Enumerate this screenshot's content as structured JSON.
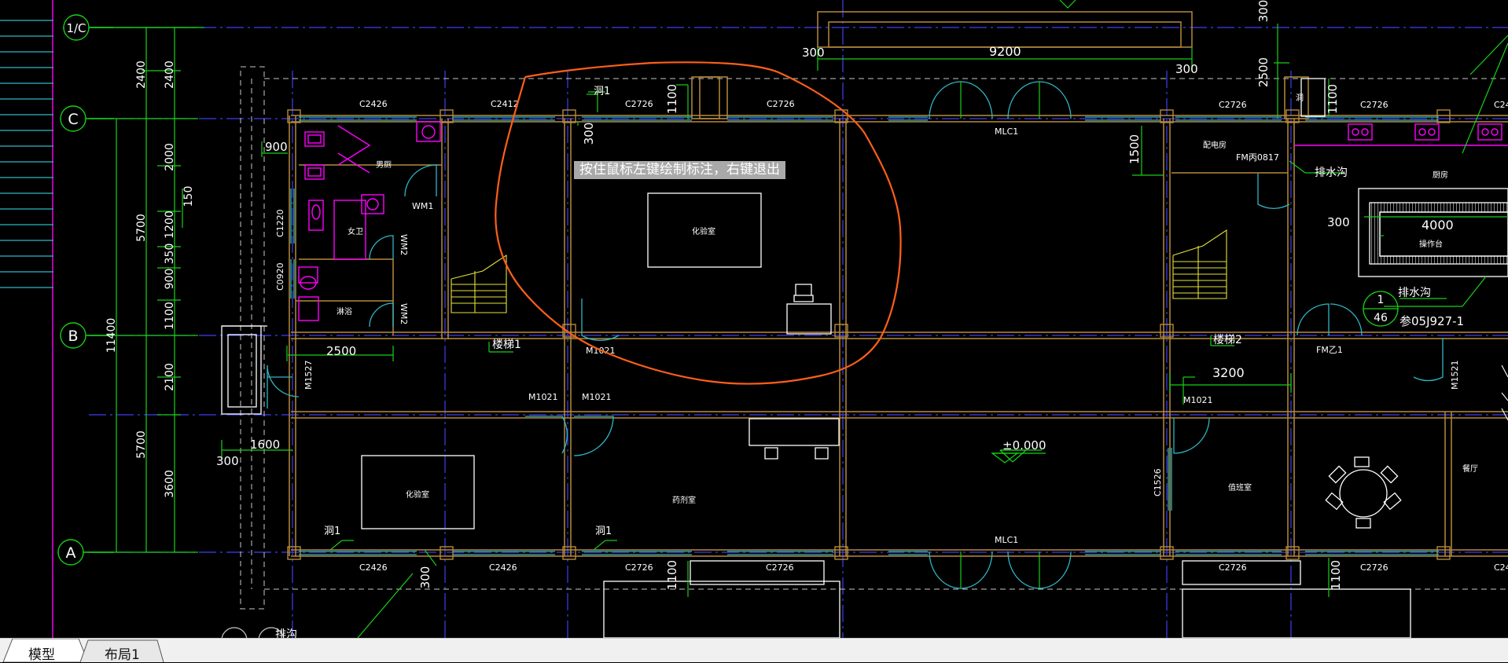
{
  "app": {
    "colors": {
      "background": "#000000",
      "wall": "#b58a3c",
      "grid": "#3f3ff5",
      "dim": "#17d017",
      "window": "#2fb6c4",
      "fixture": "#ff00ff",
      "stair": "#e6e23a",
      "markup": "#ff5f1a",
      "text": "#ffffff"
    }
  },
  "prompt": {
    "text": "按住鼠标左键绘制标注，右键退出"
  },
  "tabs": [
    {
      "label": "模型",
      "active": true
    },
    {
      "label": "布局1",
      "active": false
    }
  ],
  "axes": {
    "a1c": "1/C",
    "c": "C",
    "b": "B",
    "a": "A",
    "tag1": "1",
    "tag46": "46",
    "tag_ref": "参05J927-1"
  },
  "dims_left": {
    "d2400a": "2400",
    "d2400b": "2400",
    "d2000": "2000",
    "d1200": "1200",
    "d350": "350",
    "d900": "900",
    "d1100": "1100",
    "d2100": "2100",
    "d3600": "3600",
    "d5700a": "5700",
    "d5700b": "5700",
    "d11400": "11400",
    "d150": "150"
  },
  "dims_plan": {
    "d300a": "300",
    "d9200": "9200",
    "d300b": "300",
    "d2500": "2500",
    "d300c": "300",
    "d300d": "300",
    "d1100a": "1100",
    "d1100b": "1100",
    "d1500": "1500",
    "d900": "900",
    "d2500b": "2500",
    "d1600": "1600",
    "d300e": "300",
    "d300f": "300",
    "d3200": "3200",
    "d300g": "300",
    "d4000": "4000",
    "d1100c": "1100",
    "d1100d": "1100"
  },
  "labels": {
    "c2426a": "C2426",
    "c2412": "C2412",
    "c2726a": "C2726",
    "c2726b": "C2726",
    "c2726c": "C2726",
    "c2426b": "C2426",
    "c2426c": "C2426",
    "c2726d": "C2726",
    "c2726e": "C2726",
    "c2726f": "C2726",
    "c2726g": "C2726",
    "c2726h": "C2726",
    "c2_edge_top": "C24",
    "c2_edge_bot": "C24",
    "mlc1a": "MLC1",
    "mlc1b": "MLC1",
    "fm0817": "FM丙0817",
    "fmz1": "FM乙1",
    "wm1": "WM1",
    "wm2a": "WM2",
    "wm2b": "WM2",
    "m1527": "M1527",
    "m1521": "M1521",
    "m1021a": "M1021",
    "m1021b": "M1021",
    "m1021c": "M1021",
    "m1021d": "M1021",
    "c1220": "C1220",
    "c0920": "C0920",
    "c1526": "C1526",
    "dong1a": "洞1",
    "dong1b": "洞1",
    "dong1c": "洞1",
    "dong_small": "洞",
    "stair1": "楼梯1",
    "stair2": "楼梯2",
    "nanyu": "男厕",
    "nvyu": "女卫",
    "linyu": "淋浴",
    "room_center": "化验室",
    "room_left": "化验室",
    "room_mid": "药剂室",
    "room_r1": "配电房",
    "room_r2": "值班室",
    "kitchen": "厨房",
    "canting": "餐厅",
    "caozuotai": "操作台",
    "drain_a": "排水沟",
    "drain_b": "排水沟",
    "drain_c": "排沟",
    "elevation": "±0.000"
  }
}
